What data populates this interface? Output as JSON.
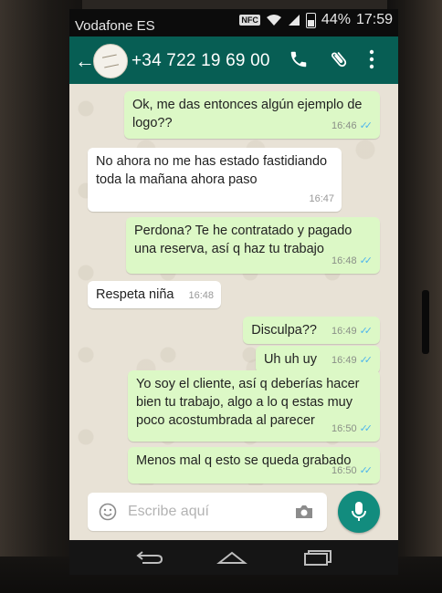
{
  "status_bar": {
    "carrier": "Vodafone ES",
    "nfc": "NFC",
    "battery": "44%",
    "time": "17:59",
    "icons": [
      "nfc-icon",
      "wifi-icon",
      "signal-icon",
      "battery-icon"
    ]
  },
  "header": {
    "contact": "+34 722 19 69 00",
    "icons": [
      "back-arrow-icon",
      "avatar",
      "phone-call-icon",
      "paperclip-icon",
      "more-vert-icon"
    ],
    "bar_color": "#075e54"
  },
  "messages": [
    {
      "dir": "out",
      "text": "Ok, me das entonces algún ejemplo de logo??",
      "time": "16:46"
    },
    {
      "dir": "in",
      "text": "No ahora no me has estado fastidiando toda la mañana ahora paso",
      "time": "16:47"
    },
    {
      "dir": "out",
      "text": "Perdona? Te he contratado y pagado una reserva, así q haz tu trabajo",
      "time": "16:48"
    },
    {
      "dir": "in",
      "text": "Respeta niña",
      "time": "16:48"
    },
    {
      "dir": "out",
      "text": "Disculpa??",
      "time": "16:49"
    },
    {
      "dir": "out",
      "text": "Uh uh uy",
      "time": "16:49"
    },
    {
      "dir": "out",
      "text": "Yo soy el cliente, así q deberías hacer bien tu trabajo, algo a lo q estas muy poco acostumbrada al parecer",
      "time": "16:50"
    },
    {
      "dir": "out",
      "text": "Menos mal q esto se queda grabado",
      "time": "16:50"
    }
  ],
  "composer": {
    "placeholder": "Escribe aquí",
    "icons": [
      "emoji-icon",
      "camera-icon",
      "mic-icon"
    ]
  },
  "navigation": {
    "icons": [
      "nav-back-icon",
      "nav-home-icon",
      "nav-recent-apps-icon"
    ]
  },
  "colors": {
    "outgoing_bubble": "#dcf8c6",
    "incoming_bubble": "#ffffff",
    "read_ticks": "#4fb6ec",
    "mic_button": "#128c7e"
  }
}
